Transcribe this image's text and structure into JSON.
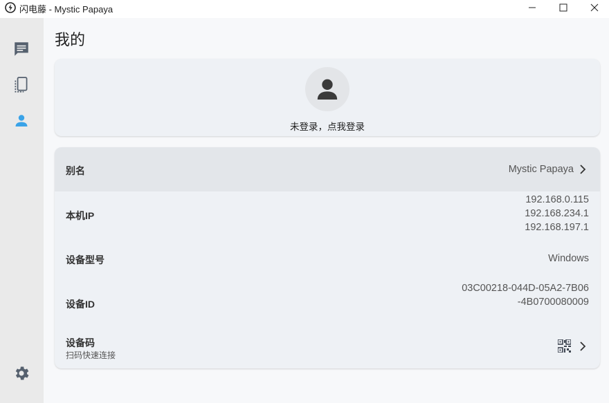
{
  "window": {
    "title": "闪电藤 - Mystic Papaya"
  },
  "sidebar": {
    "items": [
      {
        "icon": "chat-icon"
      },
      {
        "icon": "devices-icon"
      },
      {
        "icon": "user-icon",
        "active": true
      },
      {
        "icon": "gear-icon"
      }
    ]
  },
  "page": {
    "title": "我的"
  },
  "login": {
    "prompt": "未登录，点我登录"
  },
  "info": {
    "alias": {
      "label": "别名",
      "value": "Mystic Papaya"
    },
    "ip": {
      "label": "本机IP",
      "values": [
        "192.168.0.115",
        "192.168.234.1",
        "192.168.197.1"
      ]
    },
    "model": {
      "label": "设备型号",
      "value": "Windows"
    },
    "device_id": {
      "label": "设备ID",
      "line1": "03C00218-044D-05A2-7B06",
      "line2": "-4B0700080009"
    },
    "device_code": {
      "label": "设备码",
      "sublabel": "扫码快速连接"
    }
  },
  "colors": {
    "accent": "#3aa3e8",
    "sidebar_bg": "#eaeaea",
    "card_bg": "#eef1f5",
    "highlight_row": "#e3e6ea"
  }
}
